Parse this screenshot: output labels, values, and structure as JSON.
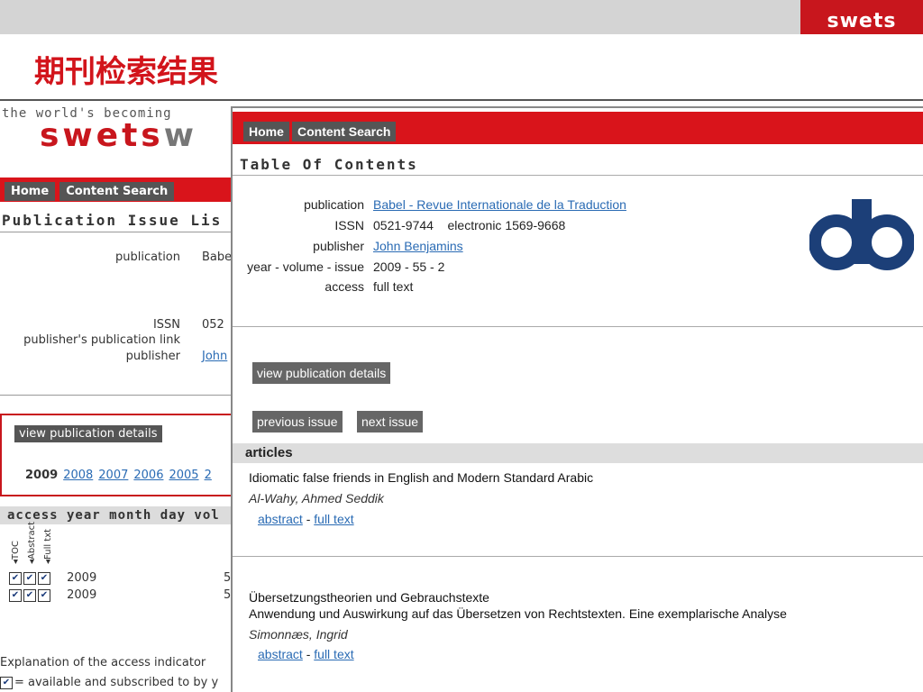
{
  "slide": {
    "brand": "swets",
    "title": "期刊检索结果"
  },
  "background_window": {
    "tagline": "the world's becoming",
    "logo": "swets",
    "logo_tail": "w",
    "nav": [
      "Home",
      "Content Search"
    ],
    "heading": "Publication Issue Lis",
    "publication_label": "publication",
    "publication_value": "Babe",
    "issn_label": "ISSN",
    "issn_value": "052",
    "publisher_link_label": "publisher's publication link",
    "publisher_label": "publisher",
    "publisher_value": "John",
    "view_details_button": "view publication details",
    "years": [
      "2009",
      "2008",
      "2007",
      "2006",
      "2005",
      "2"
    ],
    "table_header": "access year month day vol",
    "access_columns": [
      "TOC",
      "Abstract",
      "Full txt"
    ],
    "rows": [
      {
        "year": "2009",
        "trail": "5"
      },
      {
        "year": "2009",
        "trail": "5"
      }
    ],
    "explanation_title": "Explanation of the access indicator",
    "explanation_text": "= available and subscribed to by y"
  },
  "toc_window": {
    "nav": [
      "Home",
      "Content Search"
    ],
    "heading": "Table Of Contents",
    "details": {
      "publication_label": "publication",
      "publication_value": "Babel - Revue Internationale de la Traduction",
      "issn_label": "ISSN",
      "issn_value": "0521-9744    electronic 1569-9668",
      "publisher_label": "publisher",
      "publisher_value": "John Benjamins",
      "yvi_label": "year - volume - issue",
      "yvi_value": "2009 - 55 - 2",
      "access_label": "access",
      "access_value": "full text"
    },
    "publisher_logo": "db-logo",
    "view_details_button": "view publication details",
    "previous_issue_button": "previous issue",
    "next_issue_button": "next issue",
    "articles_label": "articles",
    "articles": [
      {
        "title": "Idiomatic false friends in English and Modern Standard Arabic",
        "subtitle": "",
        "author": "Al-Wahy, Ahmed Seddik",
        "abstract_link": "abstract",
        "separator": " - ",
        "fulltext_link": "full text"
      },
      {
        "title": "Übersetzungstheorien und Gebrauchstexte",
        "subtitle": "Anwendung und Auswirkung auf das Übersetzen von Rechtstexten. Eine exemplarische Analyse",
        "author": "Simonnæs, Ingrid",
        "abstract_link": "abstract",
        "separator": " - ",
        "fulltext_link": "full text"
      }
    ]
  },
  "colors": {
    "brand_red": "#d9141b",
    "button_gray": "#555555",
    "link_blue": "#2a6bb4",
    "db_logo_blue": "#1c3f78"
  }
}
